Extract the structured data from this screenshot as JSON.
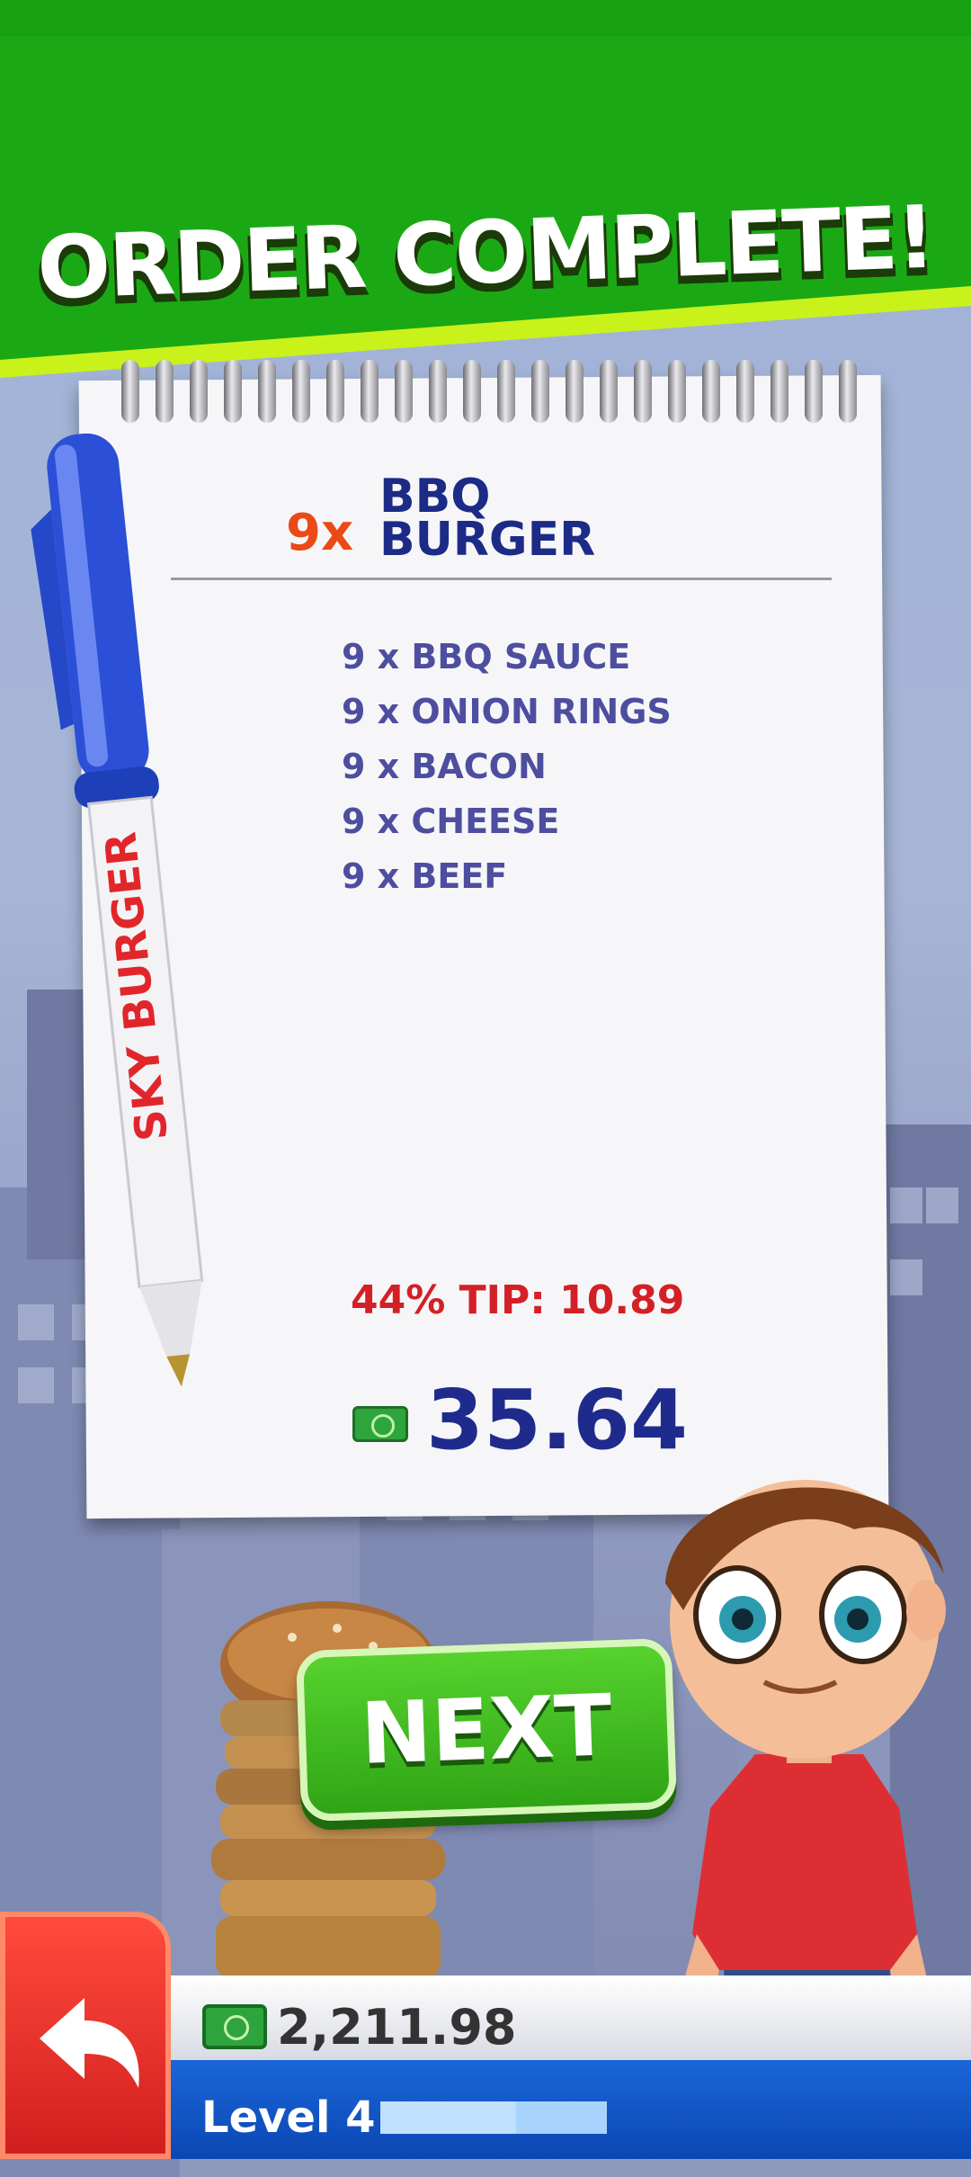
{
  "header": {
    "title": "ORDER COMPLETE!"
  },
  "order": {
    "count": "9x",
    "name_line1": "BBQ",
    "name_line2": "BURGER",
    "ingredients": [
      "9 x BBQ SAUCE",
      "9 x ONION RINGS",
      "9 x BACON",
      "9 x CHEESE",
      "9 x BEEF"
    ],
    "tip": "44% TIP: 10.89",
    "total": "35.64"
  },
  "pen": {
    "brand": "SKY BURGER"
  },
  "buttons": {
    "next_label": "NEXT"
  },
  "footer": {
    "balance": "2,211.98",
    "level_label": "Level 4",
    "level_progress": 0.6
  },
  "colors": {
    "banner_green": "#18a614",
    "banner_accent": "#c9f21a",
    "ink_blue": "#1c2b86",
    "tip_red": "#d32026",
    "next_green": "#3fbb1f",
    "back_red": "#e52b24"
  },
  "icons": {
    "money": "money-icon",
    "back": "back-arrow-icon"
  }
}
